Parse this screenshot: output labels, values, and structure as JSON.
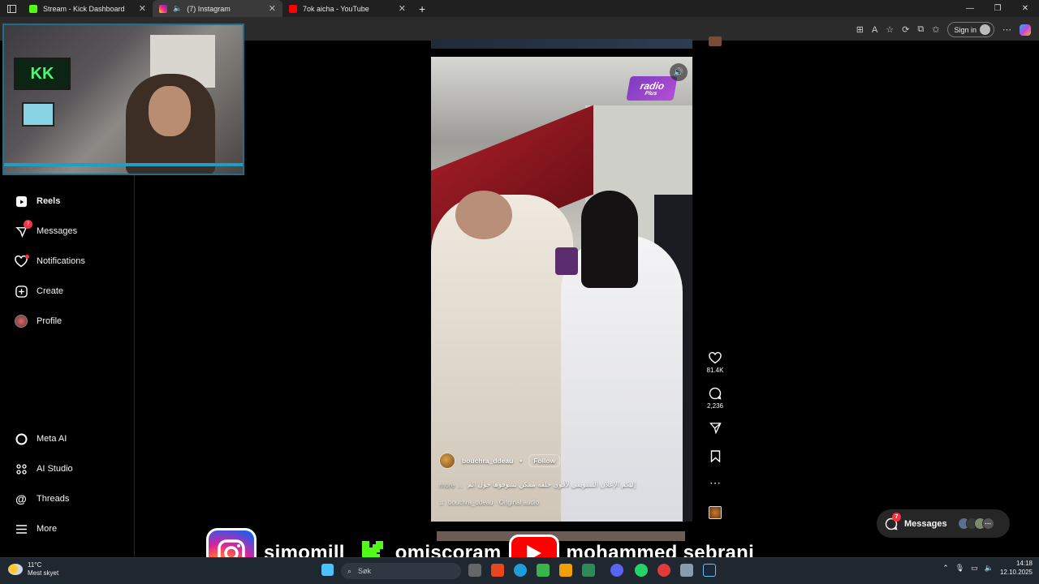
{
  "browser": {
    "tabs": [
      {
        "title": "Stream - Kick Dashboard",
        "favicon": "kick-icon",
        "color": "#53fc18"
      },
      {
        "title": "(7) Instagram",
        "favicon": "instagram-icon",
        "color": "#e1306c",
        "active": true
      },
      {
        "title": "7ok aicha - YouTube",
        "favicon": "youtube-icon",
        "color": "#ff0000"
      }
    ],
    "new_tab": "+",
    "sign_in": "Sign in",
    "window_controls": [
      "—",
      "❐",
      "✕"
    ]
  },
  "sidebar": {
    "items": [
      {
        "label": "Reels",
        "icon": "reels-icon",
        "bold": true
      },
      {
        "label": "Messages",
        "icon": "messenger-icon",
        "badge": "7"
      },
      {
        "label": "Notifications",
        "icon": "heart-icon",
        "dot": true
      },
      {
        "label": "Create",
        "icon": "plus-square-icon"
      },
      {
        "label": "Profile",
        "icon": "profile-avatar"
      }
    ],
    "bottom_items": [
      {
        "label": "Meta AI",
        "icon": "meta-ai-icon"
      },
      {
        "label": "AI Studio",
        "icon": "ai-studio-icon"
      },
      {
        "label": "Threads",
        "icon": "threads-icon"
      },
      {
        "label": "More",
        "icon": "menu-icon"
      }
    ]
  },
  "reel": {
    "watermark_main": "radio",
    "watermark_sub": "Plus",
    "username": "bouchra_ddeau",
    "separator": "•",
    "follow": "Follow",
    "caption_more": "more ...",
    "caption": "إليكم الإعلان التشويقي لأقوى حلقة ممكن تشوفوها حول الم",
    "audio": "bouchra_ddeau · Original audio"
  },
  "actions": {
    "likes": "81.4K",
    "comments": "2,236"
  },
  "messages_pill": {
    "label": "Messages",
    "badge": "7"
  },
  "stream_overlay": {
    "instagram": "simomill",
    "kick": "omiscoram",
    "youtube": "mohammed sebrani"
  },
  "taskbar": {
    "temperature": "11°C",
    "weather": "Mest skyet",
    "search_placeholder": "Søk",
    "time": "14:18",
    "date": "12.10.2025"
  }
}
